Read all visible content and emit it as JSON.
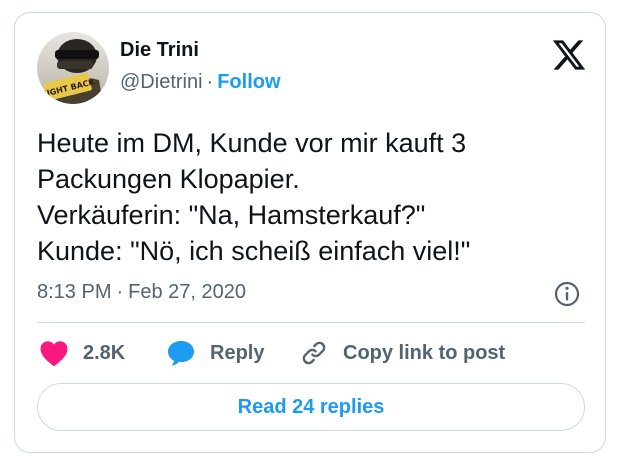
{
  "author": {
    "name": "Die Trini",
    "handle": "@Dietrini",
    "separator": "·",
    "follow_label": "Follow",
    "avatar_sign_text": "FIGHT BACK"
  },
  "header": {
    "logo_icon": "x-logo-icon"
  },
  "tweet": {
    "text": "Heute im DM, Kunde vor mir kauft 3\nPackungen Klopapier.\nVerkäuferin: \"Na, Hamsterkauf?\"\nKunde: \"Nö, ich scheiß einfach viel!\"",
    "time": "8:13 PM",
    "separator": "·",
    "date": "Feb 27, 2020"
  },
  "actions": {
    "like_count": "2.8K",
    "reply_label": "Reply",
    "copy_link_label": "Copy link to post"
  },
  "footer": {
    "read_replies_label": "Read 24 replies"
  },
  "colors": {
    "accent": "#1d9bf0",
    "like": "#f91880",
    "text": "#0f1419",
    "muted": "#536471",
    "border": "#cfd9de"
  }
}
